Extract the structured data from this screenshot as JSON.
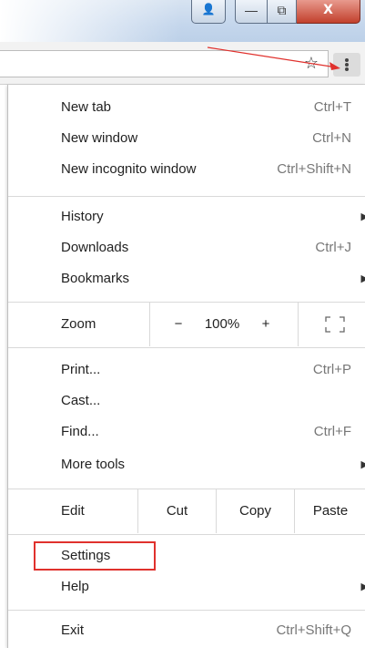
{
  "window": {
    "close_glyph": "X",
    "min_glyph": "—",
    "max_glyph": "⧉",
    "profile_glyph": "👤"
  },
  "toolbar": {
    "star_glyph": "☆"
  },
  "menu": {
    "group1": [
      {
        "label": "New tab",
        "shortcut": "Ctrl+T"
      },
      {
        "label": "New window",
        "shortcut": "Ctrl+N"
      },
      {
        "label": "New incognito window",
        "shortcut": "Ctrl+Shift+N"
      }
    ],
    "group2": [
      {
        "label": "History",
        "shortcut": ""
      },
      {
        "label": "Downloads",
        "shortcut": "Ctrl+J"
      },
      {
        "label": "Bookmarks",
        "shortcut": ""
      }
    ],
    "zoom": {
      "label": "Zoom",
      "minus": "−",
      "value": "100%",
      "plus": "+"
    },
    "group3": [
      {
        "label": "Print...",
        "shortcut": "Ctrl+P"
      },
      {
        "label": "Cast...",
        "shortcut": ""
      },
      {
        "label": "Find...",
        "shortcut": "Ctrl+F"
      },
      {
        "label": "More tools",
        "shortcut": ""
      }
    ],
    "edit": {
      "label": "Edit",
      "cut": "Cut",
      "copy": "Copy",
      "paste": "Paste"
    },
    "group4": [
      {
        "label": "Settings",
        "shortcut": ""
      },
      {
        "label": "Help",
        "shortcut": ""
      }
    ],
    "exit": {
      "label": "Exit",
      "shortcut": "Ctrl+Shift+Q"
    },
    "submenu_arrow": "▶",
    "highlight_color": "#e0312d"
  }
}
